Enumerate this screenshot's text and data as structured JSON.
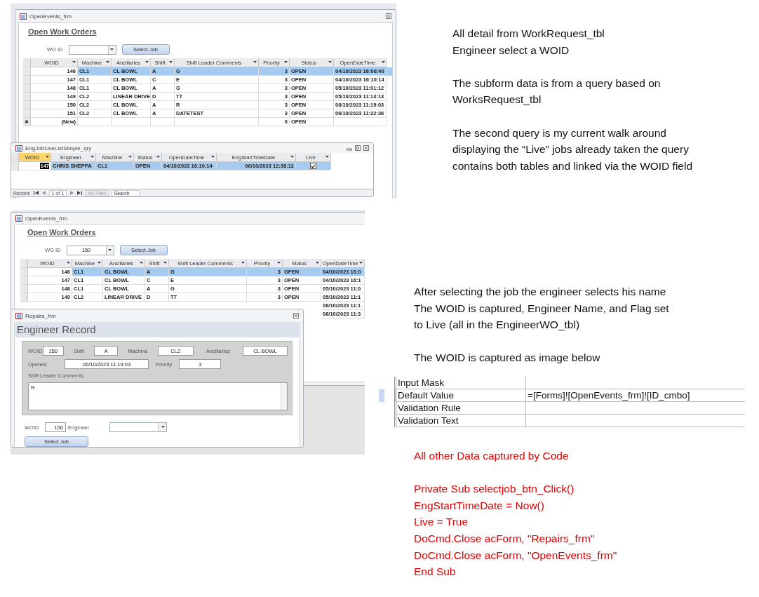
{
  "open_events_form_1": {
    "title": "OpenEvents_frm",
    "heading": "Open Work Orders",
    "wo_id_label": "WO ID",
    "button": "Select Job",
    "columns": [
      "WOID",
      "Machine",
      "Ancillaries",
      "Shift",
      "Shift Leader Comments",
      "Priority",
      "Status",
      "OpenDateTime"
    ],
    "rows": [
      {
        "woid": "146",
        "machine": "CL1",
        "ancillaries": "CL BOWL",
        "shift": "A",
        "comments": "G",
        "priority": "3",
        "status": "OPEN",
        "opened": "04/10/2023 16:08:40",
        "selected": true
      },
      {
        "woid": "147",
        "machine": "CL1",
        "ancillaries": "CL BOWL",
        "shift": "C",
        "comments": "E",
        "priority": "3",
        "status": "OPEN",
        "opened": "04/10/2023 16:10:14",
        "selected": false
      },
      {
        "woid": "148",
        "machine": "CL1",
        "ancillaries": "CL BOWL",
        "shift": "A",
        "comments": "G",
        "priority": "3",
        "status": "OPEN",
        "opened": "05/10/2023 11:01:12",
        "selected": false
      },
      {
        "woid": "149",
        "machine": "CL2",
        "ancillaries": "LINEAR DRIVE",
        "shift": "D",
        "comments": "TT",
        "priority": "3",
        "status": "OPEN",
        "opened": "05/10/2023 11:13:13",
        "selected": false
      },
      {
        "woid": "150",
        "machine": "CL2",
        "ancillaries": "CL BOWL",
        "shift": "A",
        "comments": "R",
        "priority": "3",
        "status": "OPEN",
        "opened": "06/10/2023 11:19:03",
        "selected": false
      },
      {
        "woid": "151",
        "machine": "CL2",
        "ancillaries": "CL BOWL",
        "shift": "A",
        "comments": "DATETEST",
        "priority": "3",
        "status": "OPEN",
        "opened": "06/10/2023 11:32:36",
        "selected": false
      },
      {
        "marker": "✱",
        "woid": "(New)",
        "priority": "0",
        "status": "OPEN",
        "selected": false
      }
    ]
  },
  "query_window": {
    "title": "EngJobLiveListSimple_qry",
    "columns": [
      {
        "label": "WOID",
        "active": true
      },
      {
        "label": "Engineer",
        "active": false
      },
      {
        "label": "Machine",
        "active": false
      },
      {
        "label": "Status",
        "active": false
      },
      {
        "label": "OpenDateTime",
        "active": false
      },
      {
        "label": "EngStartTimeDate",
        "active": false
      },
      {
        "label": "Live",
        "active": false
      }
    ],
    "rows": [
      {
        "woid": "147",
        "engineer": "CHRIS SHEPPA",
        "machine": "CL1",
        "status": "OPEN",
        "opened": "04/10/2023 16:10:14",
        "started": "06/10/2023 12:38:12",
        "live": true,
        "selected": true
      }
    ],
    "record_label": "Record:",
    "position": "1 of 1",
    "filter": "No Filter",
    "search": {
      "placeholder": "Search"
    }
  },
  "open_events_form_2": {
    "title": "OpenEvents_frm",
    "heading": "Open Work Orders",
    "wo_id_label": "WO ID",
    "wo_id_value": "150",
    "button": "Select Job",
    "columns": [
      "WOID",
      "Machine",
      "Ancillaries",
      "Shift",
      "Shift Leader Comments",
      "Priority",
      "Status",
      "OpenDateTime"
    ],
    "rows": [
      {
        "woid": "146",
        "machine": "CL1",
        "ancillaries": "CL BOWL",
        "shift": "A",
        "comments": "G",
        "priority": "3",
        "status": "OPEN",
        "opened": "04/10/2023 16:0",
        "selected": true
      },
      {
        "woid": "147",
        "machine": "CL1",
        "ancillaries": "CL BOWL",
        "shift": "C",
        "comments": "E",
        "priority": "3",
        "status": "OPEN",
        "opened": "04/10/2023 16:1",
        "selected": false
      },
      {
        "woid": "148",
        "machine": "CL1",
        "ancillaries": "CL BOWL",
        "shift": "A",
        "comments": "G",
        "priority": "3",
        "status": "OPEN",
        "opened": "05/10/2023 11:0",
        "selected": false
      },
      {
        "woid": "149",
        "machine": "CL2",
        "ancillaries": "LINEAR DRIVE",
        "shift": "D",
        "comments": "TT",
        "priority": "3",
        "status": "OPEN",
        "opened": "05/10/2023 11:1",
        "selected": false
      },
      {
        "opened": "06/10/2023 11:1"
      },
      {
        "opened": "06/10/2023 11:3"
      }
    ]
  },
  "repairs_form": {
    "title": "Repairs_frm",
    "heading": "Engineer Record",
    "detail_rows": [
      [
        {
          "label": "WOID",
          "value": "150"
        },
        {
          "label": "Shift",
          "value": "A"
        },
        {
          "label": "Machine",
          "value": "CL2"
        },
        {
          "label": "Ancillaries",
          "value": "CL BOWL"
        }
      ],
      [
        {
          "label": "Opened",
          "value": "06/10/2023 11:19:03"
        },
        {
          "label": "Priority",
          "value": "3"
        }
      ]
    ],
    "comments_label": "Shift Leader Comments",
    "comments_value": "R",
    "woid_label": "WOID",
    "woid_value": "150",
    "engineer_label": "Engineer",
    "button": "Select Job"
  },
  "notes": [
    {
      "paragraphs": [
        [
          "All detail from WorkRequest_tbl",
          "Engineer select a WOID"
        ],
        [
          "The subform data  is from a query based on",
          "WorksRequest_tbl"
        ],
        [
          "The second query is my current walk around",
          "displaying the “Live” jobs  already taken   the query",
          "contains both tables and linked via the WOID field"
        ]
      ]
    },
    {
      "paragraphs": [
        [
          "After selecting the job the engineer  selects his name",
          "The WOID  is captured, Engineer Name, and Flag set",
          "to Live (all in the EngineerWO_tbl)"
        ],
        [
          "The WOID is captured as image below"
        ]
      ]
    }
  ],
  "property_sheet": {
    "rows": [
      {
        "label": "Input Mask",
        "selected": false
      },
      {
        "label": "Default Value",
        "value": "=[Forms]![OpenEvents_frm]![ID_cmbo]",
        "selected": true
      },
      {
        "label": "Validation Rule",
        "selected": false
      },
      {
        "label": "Validation Text",
        "selected": false
      }
    ]
  },
  "code_note": {
    "paragraphs": [
      [
        "All other Data captured by Code"
      ],
      [
        "Private Sub selectjob_btn_Click()",
        "EngStartTimeDate = Now()",
        "Live = True",
        "DoCmd.Close acForm, \"Repairs_frm\"",
        "DoCmd.Close acForm, \"OpenEvents_frm\"",
        "End Sub"
      ]
    ]
  }
}
